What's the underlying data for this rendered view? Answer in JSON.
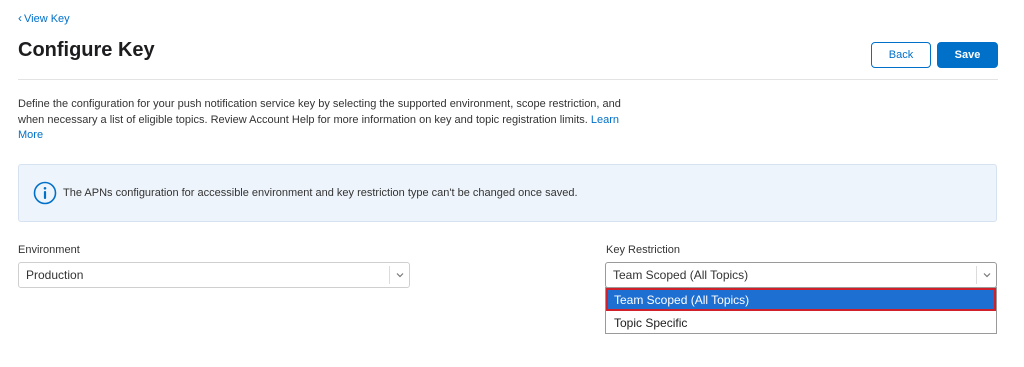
{
  "nav": {
    "back_link": "View Key"
  },
  "page": {
    "title": "Configure Key"
  },
  "actions": {
    "back_label": "Back",
    "save_label": "Save"
  },
  "description": {
    "text": "Define the configuration for your push notification service key by selecting the supported environment, scope restriction, and when necessary a list of eligible topics. Review Account Help for more information on key and topic registration limits.",
    "link": "Learn More"
  },
  "notice": {
    "icon": "info-icon",
    "text": "The APNs configuration for accessible environment and key restriction type can't be changed once saved."
  },
  "environment": {
    "label": "Environment",
    "value": "Production"
  },
  "key_restriction": {
    "label": "Key Restriction",
    "value": "Team Scoped (All Topics)",
    "options": [
      "Team Scoped (All Topics)",
      "Topic Specific"
    ]
  },
  "colors": {
    "accent": "#0070c9",
    "highlight": "#1e6fd2",
    "outline": "#d0202a"
  }
}
